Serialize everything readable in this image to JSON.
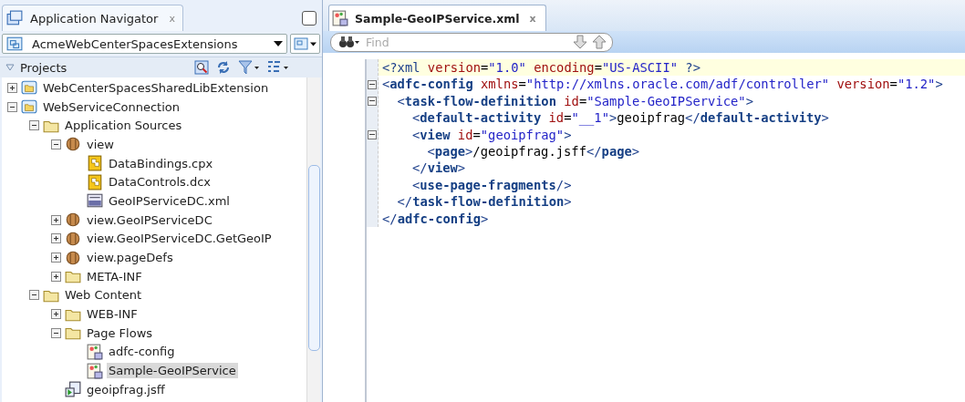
{
  "navigator": {
    "tab_title": "Application Navigator",
    "tab_close": "x",
    "application": "AcmeWebCenterSpacesExtensions",
    "section": "Projects",
    "section_expanded": true,
    "tree": [
      {
        "label": "WebCenterSpacesSharedLibExtension",
        "kind": "project",
        "expanded": false,
        "selected": false
      },
      {
        "label": "WebServiceConnection",
        "kind": "project",
        "expanded": true,
        "selected": false,
        "children": [
          {
            "label": "Application Sources",
            "kind": "folder",
            "expanded": true,
            "selected": false,
            "children": [
              {
                "label": "view",
                "kind": "package",
                "expanded": true,
                "selected": false,
                "children": [
                  {
                    "label": "DataBindings.cpx",
                    "kind": "binding",
                    "selected": false
                  },
                  {
                    "label": "DataControls.dcx",
                    "kind": "binding",
                    "selected": false
                  },
                  {
                    "label": "GeoIPServiceDC.xml",
                    "kind": "xml",
                    "selected": false
                  }
                ]
              },
              {
                "label": "view.GeoIPServiceDC",
                "kind": "package",
                "expanded": false,
                "selected": false
              },
              {
                "label": "view.GeoIPServiceDC.GetGeoIP",
                "kind": "package",
                "expanded": false,
                "selected": false
              },
              {
                "label": "view.pageDefs",
                "kind": "package",
                "expanded": false,
                "selected": false
              },
              {
                "label": "META-INF",
                "kind": "folder",
                "expanded": false,
                "selected": false
              }
            ]
          },
          {
            "label": "Web Content",
            "kind": "folder",
            "expanded": true,
            "selected": false,
            "children": [
              {
                "label": "WEB-INF",
                "kind": "folder",
                "expanded": false,
                "selected": false
              },
              {
                "label": "Page Flows",
                "kind": "folder",
                "expanded": true,
                "selected": false,
                "children": [
                  {
                    "label": "adfc-config",
                    "kind": "taskflow",
                    "selected": false
                  },
                  {
                    "label": "Sample-GeoIPService",
                    "kind": "taskflow",
                    "selected": true
                  }
                ]
              },
              {
                "label": "geoipfrag.jsff",
                "kind": "page",
                "selected": false
              }
            ]
          }
        ]
      }
    ]
  },
  "editor": {
    "tab_title": "Sample-GeoIPService.xml",
    "tab_close": "x",
    "find_placeholder": "Find",
    "lines": [
      {
        "current": true,
        "fold": false,
        "tokens": [
          {
            "kind": "tag",
            "text": "<?xml"
          },
          {
            "kind": "attr",
            "text": " version"
          },
          {
            "kind": "text",
            "text": "="
          },
          {
            "kind": "value",
            "text": "\"1.0\""
          },
          {
            "kind": "attr",
            "text": " encoding"
          },
          {
            "kind": "text",
            "text": "="
          },
          {
            "kind": "value",
            "text": "\"US-ASCII\""
          },
          {
            "kind": "tag",
            "text": " ?>"
          }
        ]
      },
      {
        "current": false,
        "fold": true,
        "tokens": [
          {
            "kind": "tag",
            "text": "<"
          },
          {
            "kind": "name",
            "text": "adfc-config"
          },
          {
            "kind": "attr",
            "text": " xmlns"
          },
          {
            "kind": "text",
            "text": "="
          },
          {
            "kind": "value",
            "text": "\"http://xmlns.oracle.com/adf/controller\""
          },
          {
            "kind": "attr",
            "text": " version"
          },
          {
            "kind": "text",
            "text": "="
          },
          {
            "kind": "value",
            "text": "\"1.2\""
          },
          {
            "kind": "tag",
            "text": ">"
          }
        ],
        "children": [
          {
            "current": false,
            "fold": true,
            "tokens": [
              {
                "kind": "tag",
                "text": "<"
              },
              {
                "kind": "name",
                "text": "task-flow-definition"
              },
              {
                "kind": "attr",
                "text": " id"
              },
              {
                "kind": "text",
                "text": "="
              },
              {
                "kind": "value",
                "text": "\"Sample-GeoIPService\""
              },
              {
                "kind": "tag",
                "text": ">"
              }
            ],
            "children": [
              {
                "current": false,
                "fold": false,
                "tokens": [
                  {
                    "kind": "tag",
                    "text": "<"
                  },
                  {
                    "kind": "name",
                    "text": "default-activity"
                  },
                  {
                    "kind": "attr",
                    "text": " id"
                  },
                  {
                    "kind": "text",
                    "text": "="
                  },
                  {
                    "kind": "value",
                    "text": "\"__1\""
                  },
                  {
                    "kind": "tag",
                    "text": ">"
                  },
                  {
                    "kind": "text",
                    "text": "geoipfrag"
                  },
                  {
                    "kind": "tag",
                    "text": "</"
                  },
                  {
                    "kind": "name",
                    "text": "default-activity"
                  },
                  {
                    "kind": "tag",
                    "text": ">"
                  }
                ]
              },
              {
                "current": false,
                "fold": true,
                "tokens": [
                  {
                    "kind": "tag",
                    "text": "<"
                  },
                  {
                    "kind": "name",
                    "text": "view"
                  },
                  {
                    "kind": "attr",
                    "text": " id"
                  },
                  {
                    "kind": "text",
                    "text": "="
                  },
                  {
                    "kind": "value",
                    "text": "\"geoipfrag\""
                  },
                  {
                    "kind": "tag",
                    "text": ">"
                  }
                ],
                "children": [
                  {
                    "current": false,
                    "fold": false,
                    "tokens": [
                      {
                        "kind": "tag",
                        "text": "<"
                      },
                      {
                        "kind": "name",
                        "text": "page"
                      },
                      {
                        "kind": "tag",
                        "text": ">"
                      },
                      {
                        "kind": "text",
                        "text": "/geoipfrag.jsff"
                      },
                      {
                        "kind": "tag",
                        "text": "</"
                      },
                      {
                        "kind": "name",
                        "text": "page"
                      },
                      {
                        "kind": "tag",
                        "text": ">"
                      }
                    ]
                  }
                ]
              },
              {
                "current": false,
                "fold": false,
                "tokens": [
                  {
                    "kind": "tag",
                    "text": "</"
                  },
                  {
                    "kind": "name",
                    "text": "view"
                  },
                  {
                    "kind": "tag",
                    "text": ">"
                  }
                ]
              },
              {
                "current": false,
                "fold": false,
                "tokens": [
                  {
                    "kind": "tag",
                    "text": "<"
                  },
                  {
                    "kind": "name",
                    "text": "use-page-fragments"
                  },
                  {
                    "kind": "tag",
                    "text": "/>"
                  }
                ]
              }
            ]
          },
          {
            "current": false,
            "fold": false,
            "tokens": [
              {
                "kind": "tag",
                "text": "</"
              },
              {
                "kind": "name",
                "text": "task-flow-definition"
              },
              {
                "kind": "tag",
                "text": ">"
              }
            ]
          }
        ]
      },
      {
        "current": false,
        "fold": false,
        "tokens": [
          {
            "kind": "tag",
            "text": "</"
          },
          {
            "kind": "name",
            "text": "adfc-config"
          },
          {
            "kind": "tag",
            "text": ">"
          }
        ]
      }
    ]
  }
}
